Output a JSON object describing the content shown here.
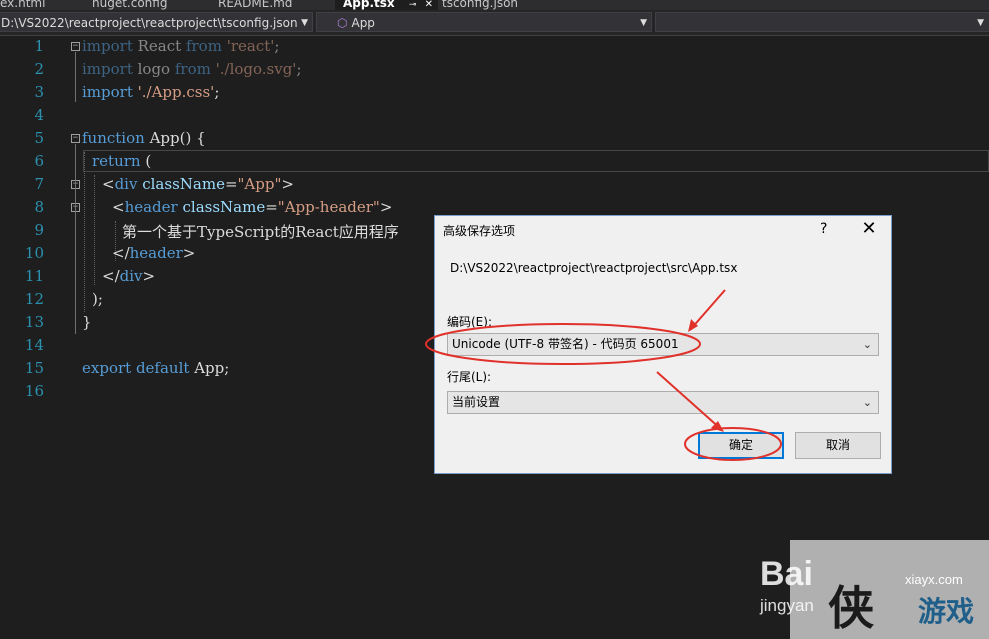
{
  "tabs": [
    "ex.html",
    "nuget.config",
    "README.md",
    "App.tsx",
    "tsconfig.json"
  ],
  "tab_pin_icon": "pin-icon",
  "tab_close_icon": "close-icon",
  "navbar": {
    "project": "D:\\VS2022\\reactproject\\reactproject\\tsconfig.json",
    "scope": "App",
    "member": ""
  },
  "editor": {
    "line_numbers": [
      "1",
      "2",
      "3",
      "4",
      "5",
      "6",
      "7",
      "8",
      "9",
      "10",
      "11",
      "12",
      "13",
      "14",
      "15",
      "16"
    ],
    "chinese_text": "第一个基于TypeScript的React应用程序"
  },
  "dialog": {
    "title": "高级保存选项",
    "help": "?",
    "close": "✕",
    "path": "D:\\VS2022\\reactproject\\reactproject\\src\\App.tsx",
    "encoding_label": "编码(E):",
    "encoding_value": "Unicode (UTF-8 带签名) - 代码页 65001",
    "line_ending_label": "行尾(L):",
    "line_ending_value": "当前设置",
    "ok": "确定",
    "cancel": "取消"
  },
  "watermark": {
    "bai": "Bai",
    "jingyan": "jingyan",
    "site": "xiayx.com",
    "game": "游戏"
  },
  "colors": {
    "keyword": "#569cd6",
    "string": "#d69d85",
    "line_number": "#2b91af",
    "annotation": "#e0312a",
    "default_button_border": "#0078d7"
  }
}
